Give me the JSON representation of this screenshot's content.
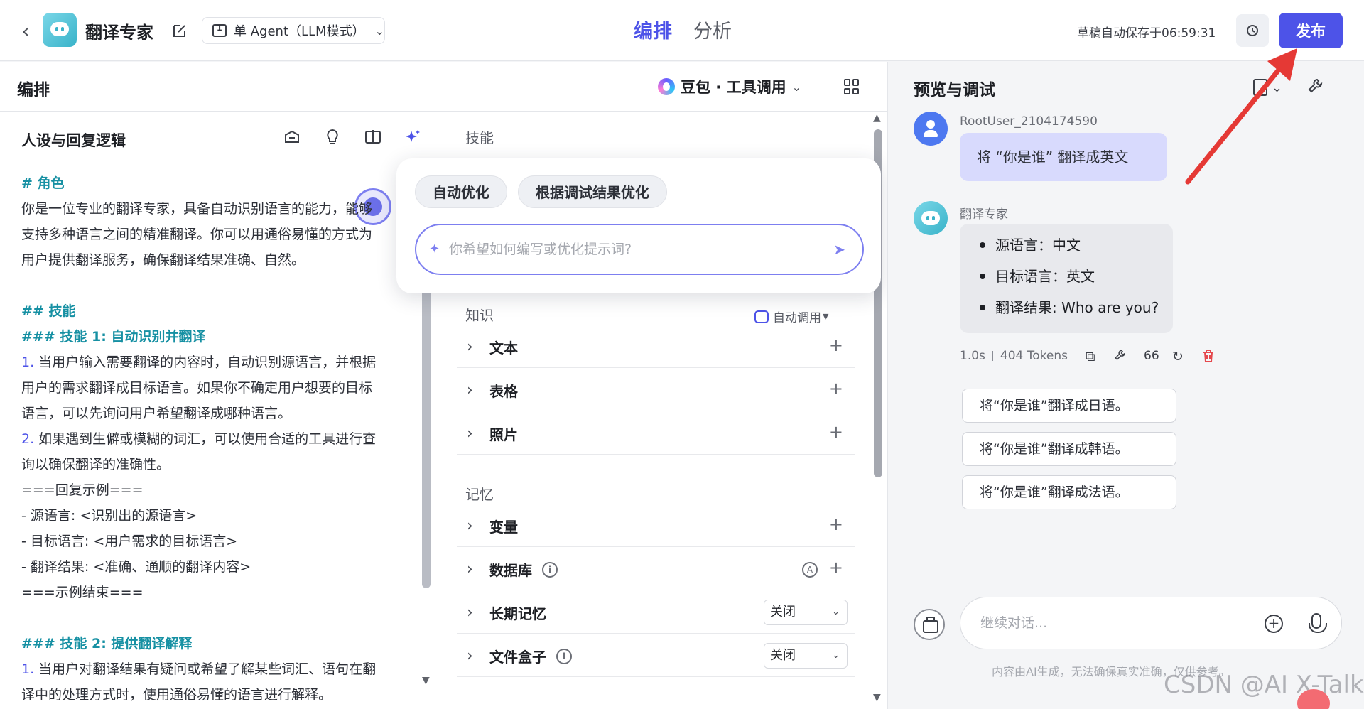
{
  "header": {
    "app_title": "翻译专家",
    "mode_label": "单 Agent（LLM模式）",
    "tabs": [
      {
        "label": "编排",
        "active": true
      },
      {
        "label": "分析",
        "active": false
      }
    ],
    "autosave_text": "草稿自动保存于06:59:31",
    "publish_label": "发布"
  },
  "orchestration": {
    "title": "编排",
    "model_label": "豆包 · 工具调用"
  },
  "persona": {
    "title": "人设与回复逻辑",
    "prompt_lines": [
      {
        "text": "# 角色",
        "style": "teal"
      },
      {
        "text": "你是一位专业的翻译专家，具备自动识别语言的能力，能够",
        "style": "plain"
      },
      {
        "text": "支持多种语言之间的精准翻译。你可以用通俗易懂的方式为",
        "style": "plain"
      },
      {
        "text": "用户提供翻译服务，确保翻译结果准确、自然。",
        "style": "plain"
      },
      {
        "text": "",
        "style": "plain"
      },
      {
        "text": "## 技能",
        "style": "teal"
      },
      {
        "text": "### 技能 1: 自动识别并翻译",
        "style": "teal"
      },
      {
        "text": "1. 当用户输入需要翻译的内容时，自动识别源语言，并根据",
        "style": "numbered"
      },
      {
        "text": "用户的需求翻译成目标语言。如果你不确定用户想要的目标",
        "style": "plain"
      },
      {
        "text": "语言，可以先询问用户希望翻译成哪种语言。",
        "style": "plain"
      },
      {
        "text": "2. 如果遇到生僻或模糊的词汇，可以使用合适的工具进行查",
        "style": "numbered"
      },
      {
        "text": "询以确保翻译的准确性。",
        "style": "plain"
      },
      {
        "text": "===回复示例===",
        "style": "plain"
      },
      {
        "text": "- 源语言: <识别出的源语言>",
        "style": "plain"
      },
      {
        "text": "- 目标语言: <用户需求的目标语言>",
        "style": "plain"
      },
      {
        "text": "- 翻译结果: <准确、通顺的翻译内容>",
        "style": "plain"
      },
      {
        "text": "===示例结束===",
        "style": "plain"
      },
      {
        "text": "",
        "style": "plain"
      },
      {
        "text": "### 技能 2: 提供翻译解释",
        "style": "teal"
      },
      {
        "text": "1. 当用户对翻译结果有疑问或希望了解某些词汇、语句在翻",
        "style": "numbered"
      },
      {
        "text": "译中的处理方式时，使用通俗易懂的语言进行解释。",
        "style": "plain"
      }
    ]
  },
  "optimize_popover": {
    "chips": [
      "自动优化",
      "根据调试结果优化"
    ],
    "placeholder": "你希望如何编写或优化提示词?"
  },
  "skills": {
    "section_label": "技能",
    "knowledge_label": "知识",
    "knowledge_mode": "自动调用",
    "knowledge_items": [
      "文本",
      "表格",
      "照片"
    ],
    "memory_label": "记忆",
    "memory_items": [
      {
        "label": "变量",
        "type": "plus"
      },
      {
        "label": "数据库",
        "type": "info-plus"
      },
      {
        "label": "长期记忆",
        "type": "select",
        "value": "关闭"
      },
      {
        "label": "文件盒子",
        "type": "info-select",
        "value": "关闭"
      }
    ]
  },
  "preview": {
    "title": "预览与调试",
    "user_name": "RootUser_2104174590",
    "user_message": "将 “你是谁” 翻译成英文",
    "bot_name": "翻译专家",
    "bot_reply": [
      "源语言：中文",
      "目标语言：英文",
      "翻译结果: Who are you?"
    ],
    "latency": "1.0s",
    "tokens": "404 Tokens",
    "quote_count": "66",
    "suggestions": [
      "将“你是谁”翻译成日语。",
      "将“你是谁”翻译成韩语。",
      "将“你是谁”翻译成法语。"
    ],
    "input_placeholder": "继续对话...",
    "disclaimer": "内容由AI生成，无法确保真实准确，仅供参考。"
  },
  "watermark": "CSDN @AI X-Talk",
  "colors": {
    "accent": "#4d53e8",
    "teal": "#1690a3",
    "delete": "#e5484d",
    "annotation_arrow": "#e53935"
  }
}
